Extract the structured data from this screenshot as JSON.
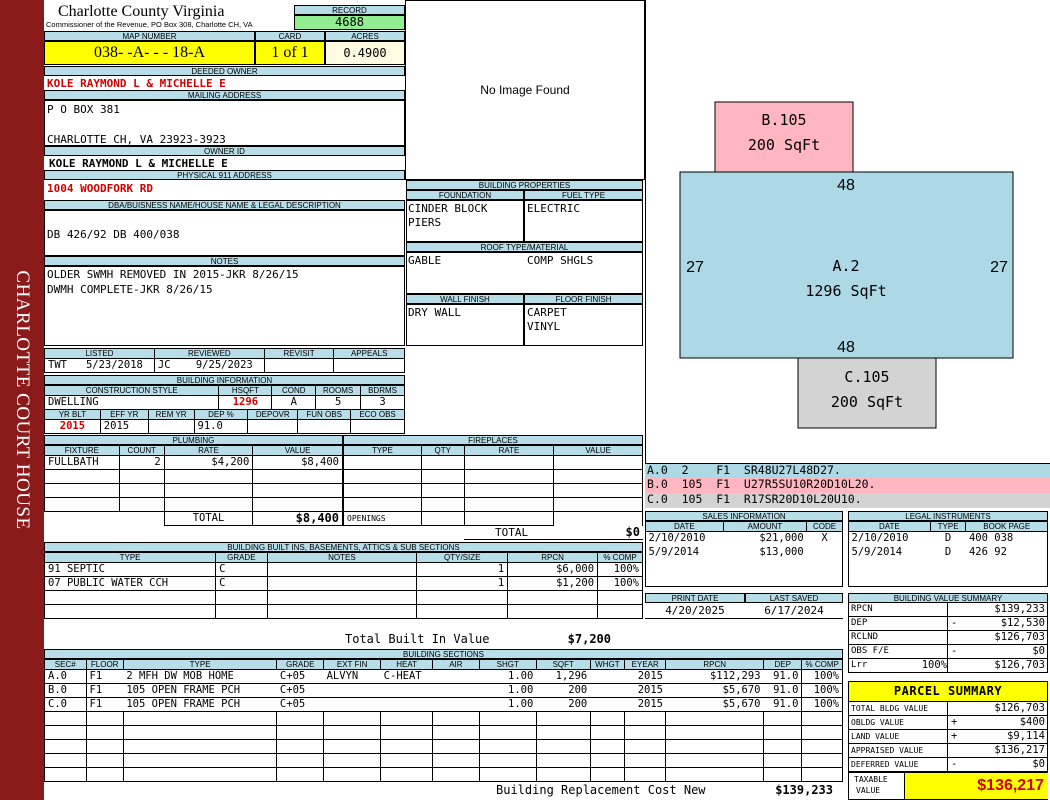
{
  "side_banner": "CHARLOTTE COURT HOUSE",
  "header": {
    "county": "Charlotte County Virginia",
    "office": "Commissioner of the Revenue, PO Box 308, Charlotte CH, VA",
    "record_label": "RECORD",
    "record": "4688",
    "map_label": "MAP NUMBER",
    "map_number": "038- -A- - - 18-A",
    "card_label": "CARD",
    "card": "1 of 1",
    "acres_label": "ACRES",
    "acres": "0.4900"
  },
  "owner": {
    "deeded_label": "DEEDED OWNER",
    "deeded": "KOLE RAYMOND L & MICHELLE E",
    "mailing_label": "MAILING ADDRESS",
    "mail_line1": "P O BOX 381",
    "mail_line2": "CHARLOTTE CH, VA 23923-3923",
    "owner_id_label": "OWNER ID",
    "owner_id": "KOLE RAYMOND L & MICHELLE E",
    "address_label": "PHYSICAL 911 ADDRESS",
    "address": "1004 WOODFORK RD"
  },
  "legal": {
    "label": "DBA/BUISNESS NAME/HOUSE NAME & LEGAL DESCRIPTION",
    "text": "DB 426/92 DB 400/038"
  },
  "notes": {
    "label": "NOTES",
    "line1": "OLDER SWMH REMOVED IN 2015-JKR 8/26/15",
    "line2": "DWMH COMPLETE-JKR 8/26/15"
  },
  "image_placeholder": "No Image Found",
  "building_properties": {
    "label": "BUILDING PROPERTIES",
    "foundation_label": "FOUNDATION",
    "foundation_line1": "CINDER BLOCK",
    "foundation_line2": "PIERS",
    "fuel_label": "FUEL TYPE",
    "fuel": "ELECTRIC",
    "roof_label": "ROOF TYPE/MATERIAL",
    "roof_type": "GABLE",
    "roof_material": "COMP SHGLS",
    "wall_label": "WALL FINISH",
    "wall": "DRY WALL",
    "floor_label": "FLOOR FINISH",
    "floor_line1": "CARPET",
    "floor_line2": "VINYL"
  },
  "review": {
    "listed_label": "LISTED",
    "reviewed_label": "REVIEWED",
    "revisit_label": "REVISIT",
    "appeals_label": "APPEALS",
    "listed_by": "TWT",
    "listed_date": "5/23/2018",
    "reviewed_by": "JC",
    "reviewed_date": "9/25/2023"
  },
  "building_info": {
    "label": "BUILDING INFORMATION",
    "style_label": "CONSTRUCTION STYLE",
    "hsqft_label": "HSQFT",
    "cond_label": "COND",
    "rooms_label": "ROOMS",
    "bdrms_label": "BDRMS",
    "style": "DWELLING",
    "hsqft": "1296",
    "cond": "A",
    "rooms": "5",
    "bdrms": "3",
    "yrblt_label": "YR BLT",
    "effyr_label": "EFF YR",
    "remyr_label": "REM YR",
    "dep_label": "DEP %",
    "depovr_label": "DEPOVR",
    "funobs_label": "FUN OBS",
    "ecoobs_label": "ECO OBS",
    "yrblt": "2015",
    "effyr": "2015",
    "dep": "91.0"
  },
  "plumbing": {
    "label": "PLUMBING",
    "cols": [
      "FIXTURE",
      "COUNT",
      "RATE",
      "VALUE"
    ],
    "rows": [
      [
        "FULLBATH",
        "2",
        "$4,200",
        "$8,400"
      ]
    ],
    "total_label": "TOTAL",
    "total": "$8,400"
  },
  "fireplaces": {
    "label": "FIREPLACES",
    "cols": [
      "TYPE",
      "QTY",
      "RATE",
      "VALUE"
    ],
    "openings_label": "OPENINGS",
    "total_label": "TOTAL",
    "total": "$0"
  },
  "built_ins": {
    "label": "BUILDING BUILT INS, BASEMENTS, ATTICS & SUB SECTIONS",
    "cols": [
      "TYPE",
      "GRADE",
      "NOTES",
      "QTY/SIZE",
      "RPCN",
      "% COMP"
    ],
    "rows": [
      [
        "91 SEPTIC",
        "C",
        "",
        "1",
        "$6,000",
        "100%"
      ],
      [
        "07 PUBLIC WATER CCH",
        "C",
        "",
        "1",
        "$1,200",
        "100%"
      ]
    ],
    "total_label": "Total Built In Value",
    "total": "$7,200"
  },
  "sections": {
    "label": "BUILDING SECTIONS",
    "cols": [
      "SEC#",
      "FLOOR",
      "TYPE",
      "GRADE",
      "EXT FIN",
      "HEAT",
      "AIR",
      "SHGT",
      "SQFT",
      "WHGT",
      "EYEAR",
      "RPCN",
      "DEP",
      "% COMP"
    ],
    "rows": [
      [
        "A.0",
        "F1",
        "2 MFH DW MOB HOME",
        "C+05",
        "ALVYN",
        "C-HEAT",
        "",
        "1.00",
        "1,296",
        "",
        "2015",
        "$112,293",
        "91.0",
        "100%"
      ],
      [
        "B.0",
        "F1",
        "105 OPEN FRAME PCH",
        "C+05",
        "",
        "",
        "",
        "1.00",
        "200",
        "",
        "2015",
        "$5,670",
        "91.0",
        "100%"
      ],
      [
        "C.0",
        "F1",
        "105 OPEN FRAME PCH",
        "C+05",
        "",
        "",
        "",
        "1.00",
        "200",
        "",
        "2015",
        "$5,670",
        "91.0",
        "100%"
      ]
    ],
    "brcn_label": "Building Replacement Cost New",
    "brcn": "$139,233"
  },
  "sketch": {
    "b_label": "B.105",
    "b_area": "200 SqFt",
    "a_label": "A.2",
    "a_area": "1296 SqFt",
    "c_label": "C.105",
    "c_area": "200 SqFt",
    "dim_top": "48",
    "dim_bottom": "48",
    "dim_left": "27",
    "dim_right": "27",
    "colors": {
      "a": "#add8e6",
      "b": "#ffb6c1",
      "c": "#d3d3d3"
    }
  },
  "vectors": [
    "A.0  2    F1  SR48U27L48D27.",
    "B.0  105  F1  U27R5SU10R20D10L20.",
    "C.0  105  F1  R17SR20D10L20U10."
  ],
  "sales": {
    "label": "SALES INFORMATION",
    "cols": [
      "DATE",
      "AMOUNT",
      "CODE"
    ],
    "rows": [
      [
        "2/10/2010",
        "$21,000",
        "X"
      ],
      [
        "5/9/2014",
        "$13,000",
        ""
      ]
    ]
  },
  "legal_instruments": {
    "label": "LEGAL INSTRUMENTS",
    "cols": [
      "DATE",
      "TYPE",
      "BOOK PAGE"
    ],
    "rows": [
      [
        "2/10/2010",
        "D",
        "400 038"
      ],
      [
        "5/9/2014",
        "D",
        "426 92"
      ]
    ]
  },
  "print_info": {
    "print_label": "PRINT DATE",
    "saved_label": "LAST SAVED",
    "print_date": "4/20/2025",
    "saved_date": "6/17/2024"
  },
  "value_summary": {
    "label": "BUILDING VALUE SUMMARY",
    "rows": [
      {
        "label": "RPCN",
        "sign": "",
        "value": "$139,233"
      },
      {
        "label": "DEP",
        "sign": "-",
        "value": "$12,530"
      },
      {
        "label": "RCLND",
        "sign": "",
        "value": "$126,703"
      },
      {
        "label": "OBS F/E",
        "sign": "-",
        "value": "$0"
      },
      {
        "label": "Lrr",
        "pct": "100%",
        "sign": "",
        "value": "$126,703"
      }
    ]
  },
  "parcel": {
    "label": "PARCEL SUMMARY",
    "rows": [
      {
        "label": "TOTAL BLDG VALUE",
        "sign": "",
        "value": "$126,703"
      },
      {
        "label": "OBLDG VALUE",
        "sign": "+",
        "value": "$400"
      },
      {
        "label": "LAND VALUE",
        "sign": "+",
        "value": "$9,114"
      },
      {
        "label": "APPRAISED VALUE",
        "sign": "",
        "value": "$136,217"
      },
      {
        "label": "DEFERRED VALUE",
        "sign": "-",
        "value": "$0"
      }
    ],
    "taxable_label_1": "TAXABLE",
    "taxable_label_2": "VALUE",
    "taxable": "$136,217"
  }
}
